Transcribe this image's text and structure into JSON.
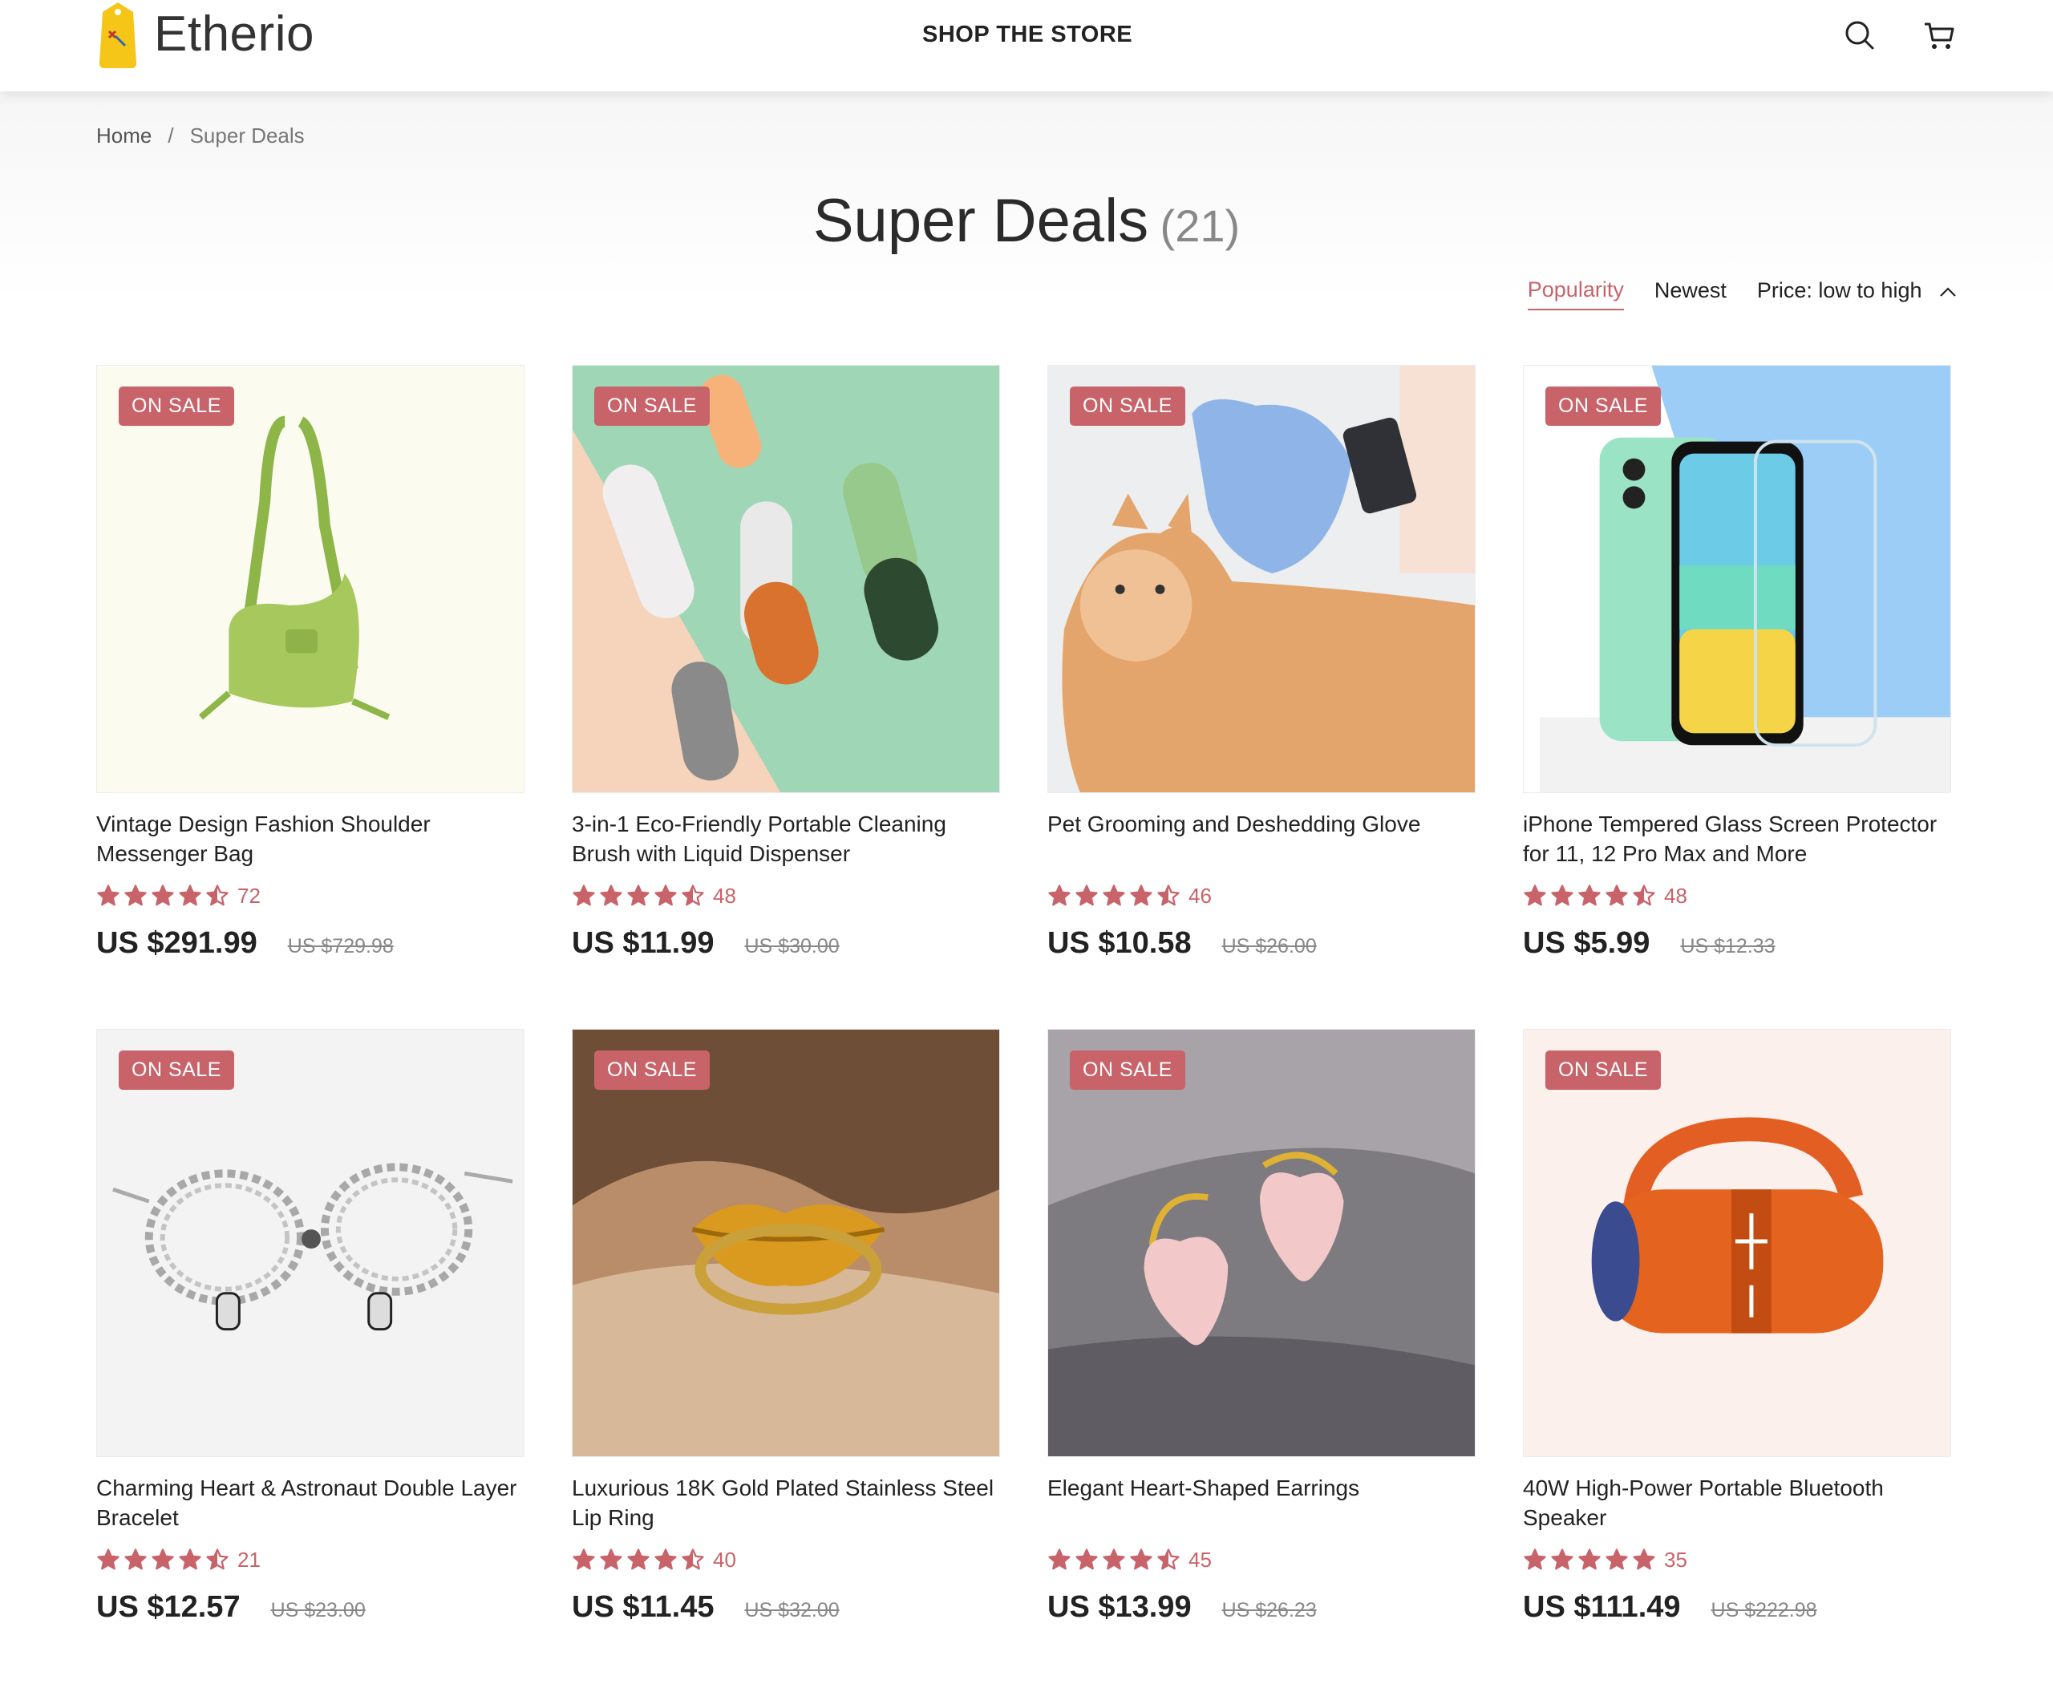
{
  "brand": {
    "name": "Etherio"
  },
  "header": {
    "nav_label": "SHOP THE STORE",
    "search_icon": "search-icon",
    "cart_icon": "cart-icon"
  },
  "breadcrumb": {
    "home": "Home",
    "separator": "/",
    "current": "Super Deals"
  },
  "page": {
    "title": "Super Deals",
    "count": "(21)"
  },
  "sort": {
    "options": [
      "Popularity",
      "Newest",
      "Price: low to high"
    ],
    "active": "Popularity"
  },
  "colors": {
    "accent": "#c9636a",
    "logo_yellow": "#f5c518"
  },
  "products": [
    {
      "badge": "ON SALE",
      "name": "Vintage Design Fashion Shoulder Messenger Bag",
      "rating": 4.5,
      "reviews": "72",
      "price": "US $291.99",
      "old_price": "US $729.98"
    },
    {
      "badge": "ON SALE",
      "name": "3-in-1 Eco-Friendly Portable Cleaning Brush with Liquid Dispenser",
      "rating": 4.5,
      "reviews": "48",
      "price": "US $11.99",
      "old_price": "US $30.00"
    },
    {
      "badge": "ON SALE",
      "name": "Pet Grooming and Deshedding Glove",
      "rating": 4.5,
      "reviews": "46",
      "price": "US $10.58",
      "old_price": "US $26.00"
    },
    {
      "badge": "ON SALE",
      "name": "iPhone Tempered Glass Screen Protector for 11, 12 Pro Max and More",
      "rating": 4.5,
      "reviews": "48",
      "price": "US $5.99",
      "old_price": "US $12.33"
    },
    {
      "badge": "ON SALE",
      "name": "Charming Heart & Astronaut Double Layer Bracelet",
      "rating": 4.5,
      "reviews": "21",
      "price": "US $12.57",
      "old_price": "US $23.00"
    },
    {
      "badge": "ON SALE",
      "name": "Luxurious 18K Gold Plated Stainless Steel Lip Ring",
      "rating": 4.5,
      "reviews": "40",
      "price": "US $11.45",
      "old_price": "US $32.00"
    },
    {
      "badge": "ON SALE",
      "name": "Elegant Heart-Shaped Earrings",
      "rating": 4.5,
      "reviews": "45",
      "price": "US $13.99",
      "old_price": "US $26.23"
    },
    {
      "badge": "ON SALE",
      "name": "40W High-Power Portable Bluetooth Speaker",
      "rating": 5,
      "reviews": "35",
      "price": "US $111.49",
      "old_price": "US $222.98"
    }
  ]
}
